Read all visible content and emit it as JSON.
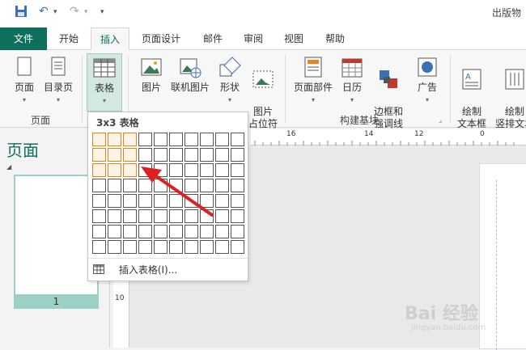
{
  "app": {
    "title": "出版物"
  },
  "qat": {
    "undo_glyph": "↶",
    "redo_glyph": "↷",
    "more_glyph": "▾"
  },
  "tabs": [
    "文件",
    "开始",
    "插入",
    "页面设计",
    "邮件",
    "审阅",
    "视图",
    "帮助"
  ],
  "ribbon": {
    "buttons": [
      "页面",
      "目录页",
      "表格",
      "图片",
      "联机图片",
      "形状",
      "图片\n占位符",
      "页面部件",
      "日历",
      "边框和\n强调线",
      "广告",
      "绘制\n文本框",
      "绘制\n竖排文本"
    ],
    "groups": {
      "pages": "页面",
      "building_blocks": "构建基块"
    }
  },
  "left_pane": {
    "title": "页面",
    "page_number": "1"
  },
  "ruler": {
    "h_labels": [
      "16",
      "14",
      "12",
      "0"
    ],
    "v_label": "10"
  },
  "table_dropdown": {
    "title": "3x3 表格",
    "rows": 8,
    "cols": 10,
    "selected_rows": 3,
    "selected_cols": 3,
    "insert_label": "插入表格(I)..."
  },
  "watermark": {
    "text": "Bai 经验",
    "sub": "jingyan.baidu.com"
  },
  "colors": {
    "accent": "#0e6f5c",
    "selection": "#e8841b",
    "arrow": "#e02020"
  }
}
